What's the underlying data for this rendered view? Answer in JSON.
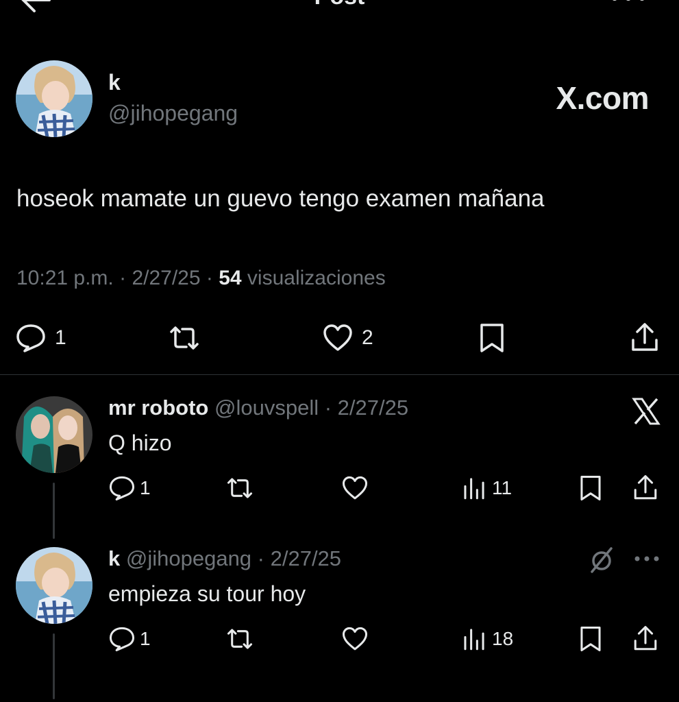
{
  "header": {
    "title": "Post"
  },
  "post": {
    "author_name": "k",
    "author_handle": "@jihopegang",
    "watermark": "X.com",
    "text": "hoseok mamate un guevo tengo examen mañana",
    "time": "10:21 p.m.",
    "date": "2/27/25",
    "views_count": "54",
    "views_label": "visualizaciones",
    "replies": "1",
    "likes": "2"
  },
  "replies": [
    {
      "name": "mr roboto",
      "handle": "@louvspell",
      "date": "2/27/25",
      "text": "Q hizo",
      "reply_count": "1",
      "views": "11"
    },
    {
      "name": "k",
      "handle": "@jihopegang",
      "date": "2/27/25",
      "text": "empieza su tour hoy",
      "reply_count": "1",
      "views": "18"
    }
  ],
  "icons": {
    "back": "arrow-left-icon",
    "more": "more-dots-icon",
    "reply": "speech-bubble-icon",
    "repost": "repost-icon",
    "like": "heart-icon",
    "bookmark": "bookmark-icon",
    "share": "share-icon",
    "views": "bar-chart-icon",
    "x": "x-logo-icon"
  }
}
